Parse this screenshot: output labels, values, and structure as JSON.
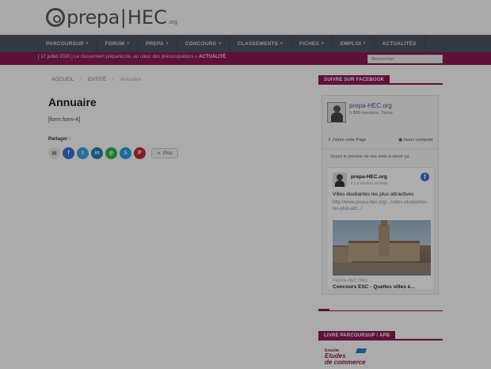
{
  "logo": {
    "word1": "prepa",
    "word2": "HEC",
    "tld": ".org"
  },
  "nav": {
    "items": [
      {
        "label": "PARCOURSUP",
        "caret": "▾"
      },
      {
        "label": "FORUM",
        "caret": "▾"
      },
      {
        "label": "PREPA",
        "caret": "▾"
      },
      {
        "label": "CONCOURS",
        "caret": "▾"
      },
      {
        "label": "CLASSEMENTS",
        "caret": "▾"
      },
      {
        "label": "FICHES",
        "caret": "▾"
      },
      {
        "label": "EMPLOI",
        "caret": "▾"
      },
      {
        "label": "ACTUALITÉS",
        "caret": ""
      }
    ]
  },
  "ticker": {
    "date": "[ 17 juillet 2020 ]",
    "text": "Le classement prépa/école, au cœur des préoccupations",
    "tag": "ACTUALITÉ"
  },
  "search": {
    "placeholder": "Rechercher"
  },
  "breadcrumb": {
    "home": "ACCUEIL",
    "section": "ENTITÉ",
    "current": "Annuaire",
    "sep": "/"
  },
  "page": {
    "title": "Annuaire",
    "form_text": "[form form-4]",
    "share_label": "Partager :",
    "share_more": "Plus"
  },
  "sidebar": {
    "facebook_title": "SUIVRE SUR FACEBOOK",
    "fb": {
      "page_name": "prepa-HEC.org",
      "likes": "5 886 mentions J'aime",
      "like_button": "J'aime cette Page",
      "contact_button": "Nous contacter",
      "first_friends": "Soyez le premier de vos amis à aimer ça",
      "post": {
        "author": "prepa-HEC.org",
        "time": "il y a environ un mois",
        "text": "Villes étudiantes les plus attractives",
        "link": "http://www.prepa-hec.org/.../villes-etudiantes-les-plus-attr.../",
        "domain": "PREPA-HEC.ORG",
        "headline": "Concours ESC - Quelles villes é..."
      }
    },
    "livre_title": "LIVRE PARCOURSUP / APB",
    "livre_cover": {
      "line1": "Ensuite",
      "line2": "Etudes",
      "line3": "de commerce"
    }
  },
  "colors": {
    "nav_bg": "#4f5561",
    "accent": "#8b1a54",
    "facebook": "#3b5998"
  }
}
